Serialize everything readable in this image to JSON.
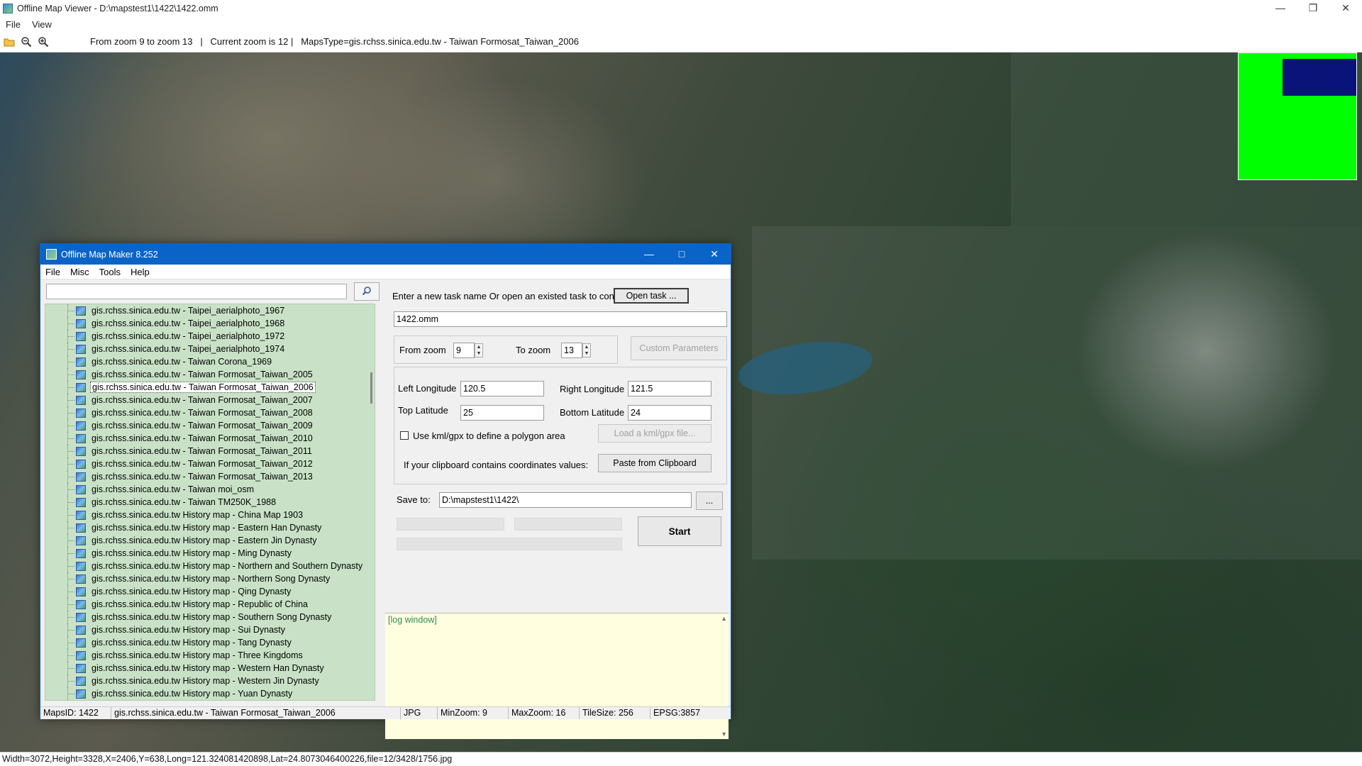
{
  "viewer": {
    "title": "Offline Map Viewer - D:\\mapstest1\\1422\\1422.omm",
    "menu": [
      "File",
      "View"
    ],
    "toolbar_status": "From zoom 9 to zoom 13   |   Current zoom is 12 |   MapsType=gis.rchss.sinica.edu.tw - Taiwan Formosat_Taiwan_2006",
    "status_bar": "Width=3072,Height=3328,X=2406,Y=638,Long=121.324081420898,Lat=24.8073046400226,file=12/3428/1756.jpg",
    "icons": [
      "open-folder-icon",
      "zoom-out-icon",
      "zoom-in-icon"
    ],
    "overview_colors": {
      "background": "#00ff00",
      "viewport": "#0a1478"
    }
  },
  "dialog": {
    "title": "Offline Map Maker 8.252",
    "menu": [
      "File",
      "Misc",
      "Tools",
      "Help"
    ],
    "search": {
      "value": "",
      "placeholder": ""
    },
    "map_list": [
      "gis.rchss.sinica.edu.tw - Taipei_aerialphoto_1967",
      "gis.rchss.sinica.edu.tw - Taipei_aerialphoto_1968",
      "gis.rchss.sinica.edu.tw - Taipei_aerialphoto_1972",
      "gis.rchss.sinica.edu.tw - Taipei_aerialphoto_1974",
      "gis.rchss.sinica.edu.tw - Taiwan Corona_1969",
      "gis.rchss.sinica.edu.tw - Taiwan Formosat_Taiwan_2005",
      "gis.rchss.sinica.edu.tw - Taiwan Formosat_Taiwan_2006",
      "gis.rchss.sinica.edu.tw - Taiwan Formosat_Taiwan_2007",
      "gis.rchss.sinica.edu.tw - Taiwan Formosat_Taiwan_2008",
      "gis.rchss.sinica.edu.tw - Taiwan Formosat_Taiwan_2009",
      "gis.rchss.sinica.edu.tw - Taiwan Formosat_Taiwan_2010",
      "gis.rchss.sinica.edu.tw - Taiwan Formosat_Taiwan_2011",
      "gis.rchss.sinica.edu.tw - Taiwan Formosat_Taiwan_2012",
      "gis.rchss.sinica.edu.tw - Taiwan Formosat_Taiwan_2013",
      "gis.rchss.sinica.edu.tw - Taiwan moi_osm",
      "gis.rchss.sinica.edu.tw - Taiwan TM250K_1988",
      "gis.rchss.sinica.edu.tw History map - China Map 1903",
      "gis.rchss.sinica.edu.tw History map - Eastern Han Dynasty",
      "gis.rchss.sinica.edu.tw History map - Eastern Jin Dynasty",
      "gis.rchss.sinica.edu.tw History map - Ming Dynasty",
      "gis.rchss.sinica.edu.tw History map - Northern and Southern Dynasty",
      "gis.rchss.sinica.edu.tw History map - Northern Song Dynasty",
      "gis.rchss.sinica.edu.tw History map - Qing Dynasty",
      "gis.rchss.sinica.edu.tw History map - Republic of China",
      "gis.rchss.sinica.edu.tw History map - Southern Song Dynasty",
      "gis.rchss.sinica.edu.tw History map - Sui Dynasty",
      "gis.rchss.sinica.edu.tw History map - Tang Dynasty",
      "gis.rchss.sinica.edu.tw History map - Three Kingdoms",
      "gis.rchss.sinica.edu.tw History map - Western Han Dynasty",
      "gis.rchss.sinica.edu.tw History map - Western Jin Dynasty",
      "gis.rchss.sinica.edu.tw History map - Yuan Dynasty"
    ],
    "selected_map": "gis.rchss.sinica.edu.tw - Taiwan Formosat_Taiwan_2006",
    "task_prompt": "Enter a new task name Or open an existed task to continue:",
    "open_task_label": "Open task ...",
    "task_name": "1422.omm",
    "from_zoom_label": "From zoom",
    "from_zoom_value": "9",
    "to_zoom_label": "To zoom",
    "to_zoom_value": "13",
    "custom_params_label": "Custom Parameters",
    "left_lon_label": "Left Longitude",
    "left_lon_value": "120.5",
    "right_lon_label": "Right Longitude",
    "right_lon_value": "121.5",
    "top_lat_label": "Top Latitude",
    "top_lat_value": "25",
    "bottom_lat_label": "Bottom Latitude",
    "bottom_lat_value": "24",
    "kml_checkbox_label": "Use kml/gpx to define a polygon area",
    "load_kml_label": "Load a kml/gpx file...",
    "clipboard_prompt": "If your clipboard contains coordinates values:",
    "paste_label": "Paste from Clipboard",
    "save_to_label": "Save to:",
    "save_to_value": "D:\\mapstest1\\1422\\",
    "browse_label": "...",
    "start_label": "Start",
    "log_text": "[log window]",
    "status": {
      "maps_id": "MapsID: 1422",
      "map_name": "gis.rchss.sinica.edu.tw - Taiwan Formosat_Taiwan_2006",
      "format": "JPG",
      "min_zoom": "MinZoom: 9",
      "max_zoom": "MaxZoom: 16",
      "tile_size": "TileSize: 256",
      "epsg": "EPSG:3857"
    }
  }
}
